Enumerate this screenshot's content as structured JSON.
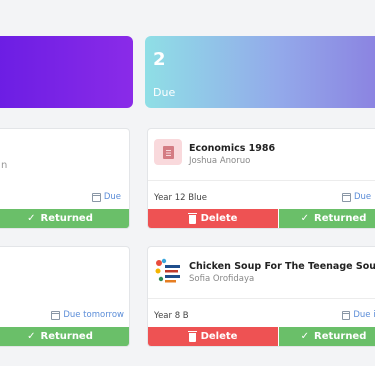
{
  "stats": {
    "due": {
      "value": "2",
      "label": "Due"
    }
  },
  "left_column": {
    "cards": [
      {
        "partial_text": "n",
        "due_label": "Due",
        "returned_label": "Returned"
      },
      {
        "due_label": "Due tomorrow",
        "returned_label": "Returned"
      }
    ]
  },
  "right_column": {
    "cards": [
      {
        "title": "Economics 1986",
        "author": "Joshua Anoruo",
        "class": "Year 12 Blue",
        "due_label": "Due",
        "delete_label": "Delete",
        "returned_label": "Returned",
        "icon": "clipboard-icon"
      },
      {
        "title": "Chicken Soup For The Teenage Soul",
        "author": "Sofia Orofidaya",
        "class": "Year 8 B",
        "due_label": "Due in",
        "delete_label": "Delete",
        "returned_label": "Returned",
        "icon": "book-cover-image"
      }
    ]
  },
  "colors": {
    "returned": "#6abf69",
    "delete": "#ee5253",
    "due_text": "#5b8dd8",
    "purple_card": "#7b22e6",
    "gradient_card_start": "#8fdfe6",
    "gradient_card_end": "#8a7ee0"
  }
}
